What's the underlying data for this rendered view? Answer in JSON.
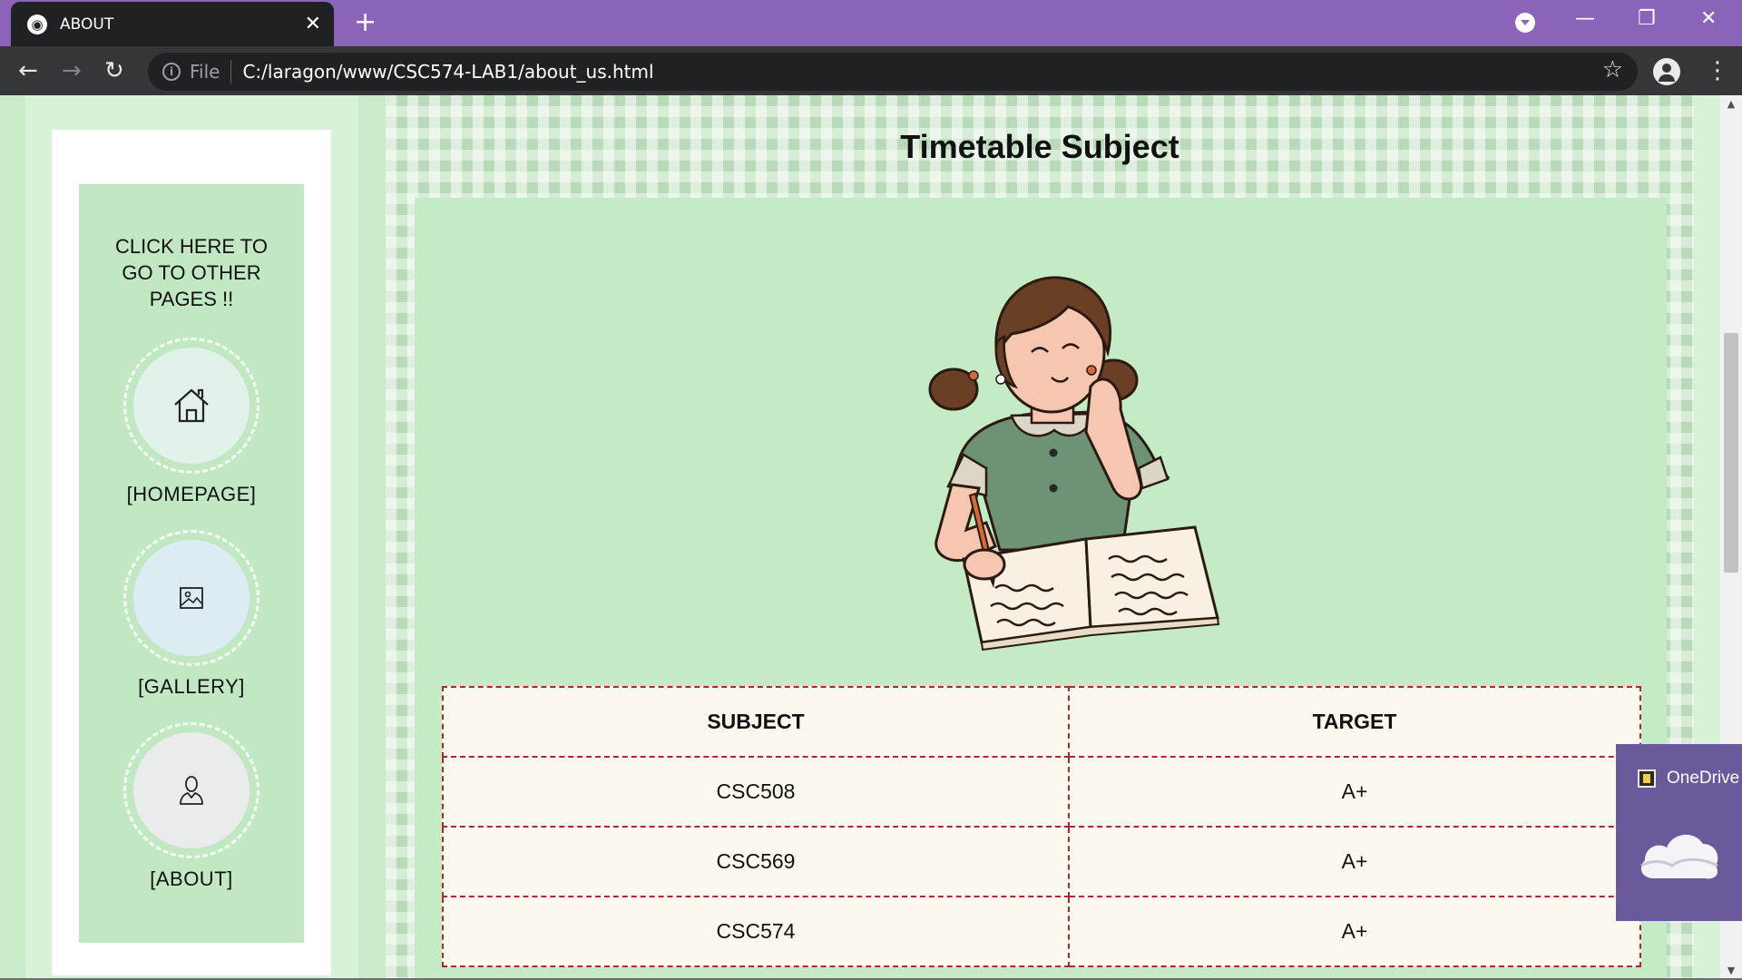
{
  "browser": {
    "tab_title": "ABOUT",
    "url_scheme": "File",
    "url": "C:/laragon/www/CSC574-LAB1/about_us.html"
  },
  "sidebar": {
    "heading": "CLICK HERE TO GO TO OTHER PAGES !!",
    "items": [
      {
        "label": "[HOMEPAGE]",
        "icon": "home-icon",
        "circle_color": "#e3f1eb"
      },
      {
        "label": "[GALLERY]",
        "icon": "image-icon",
        "circle_color": "#dcecf2"
      },
      {
        "label": "[ABOUT]",
        "icon": "user-icon",
        "circle_color": "#e9ecea"
      }
    ]
  },
  "main": {
    "title": "Timetable Subject",
    "table": {
      "headers": [
        "SUBJECT",
        "TARGET"
      ],
      "rows": [
        [
          "CSC508",
          "A+"
        ],
        [
          "CSC569",
          "A+"
        ],
        [
          "CSC574",
          "A+"
        ]
      ]
    }
  },
  "toast": {
    "label": "OneDrive"
  },
  "colors": {
    "titlebar": "#8b63b9",
    "sidebar_bg": "#c2e8c3",
    "content_bg": "#c4ebc4",
    "table_border": "#a72a33",
    "table_bg": "#fdf8ee"
  }
}
